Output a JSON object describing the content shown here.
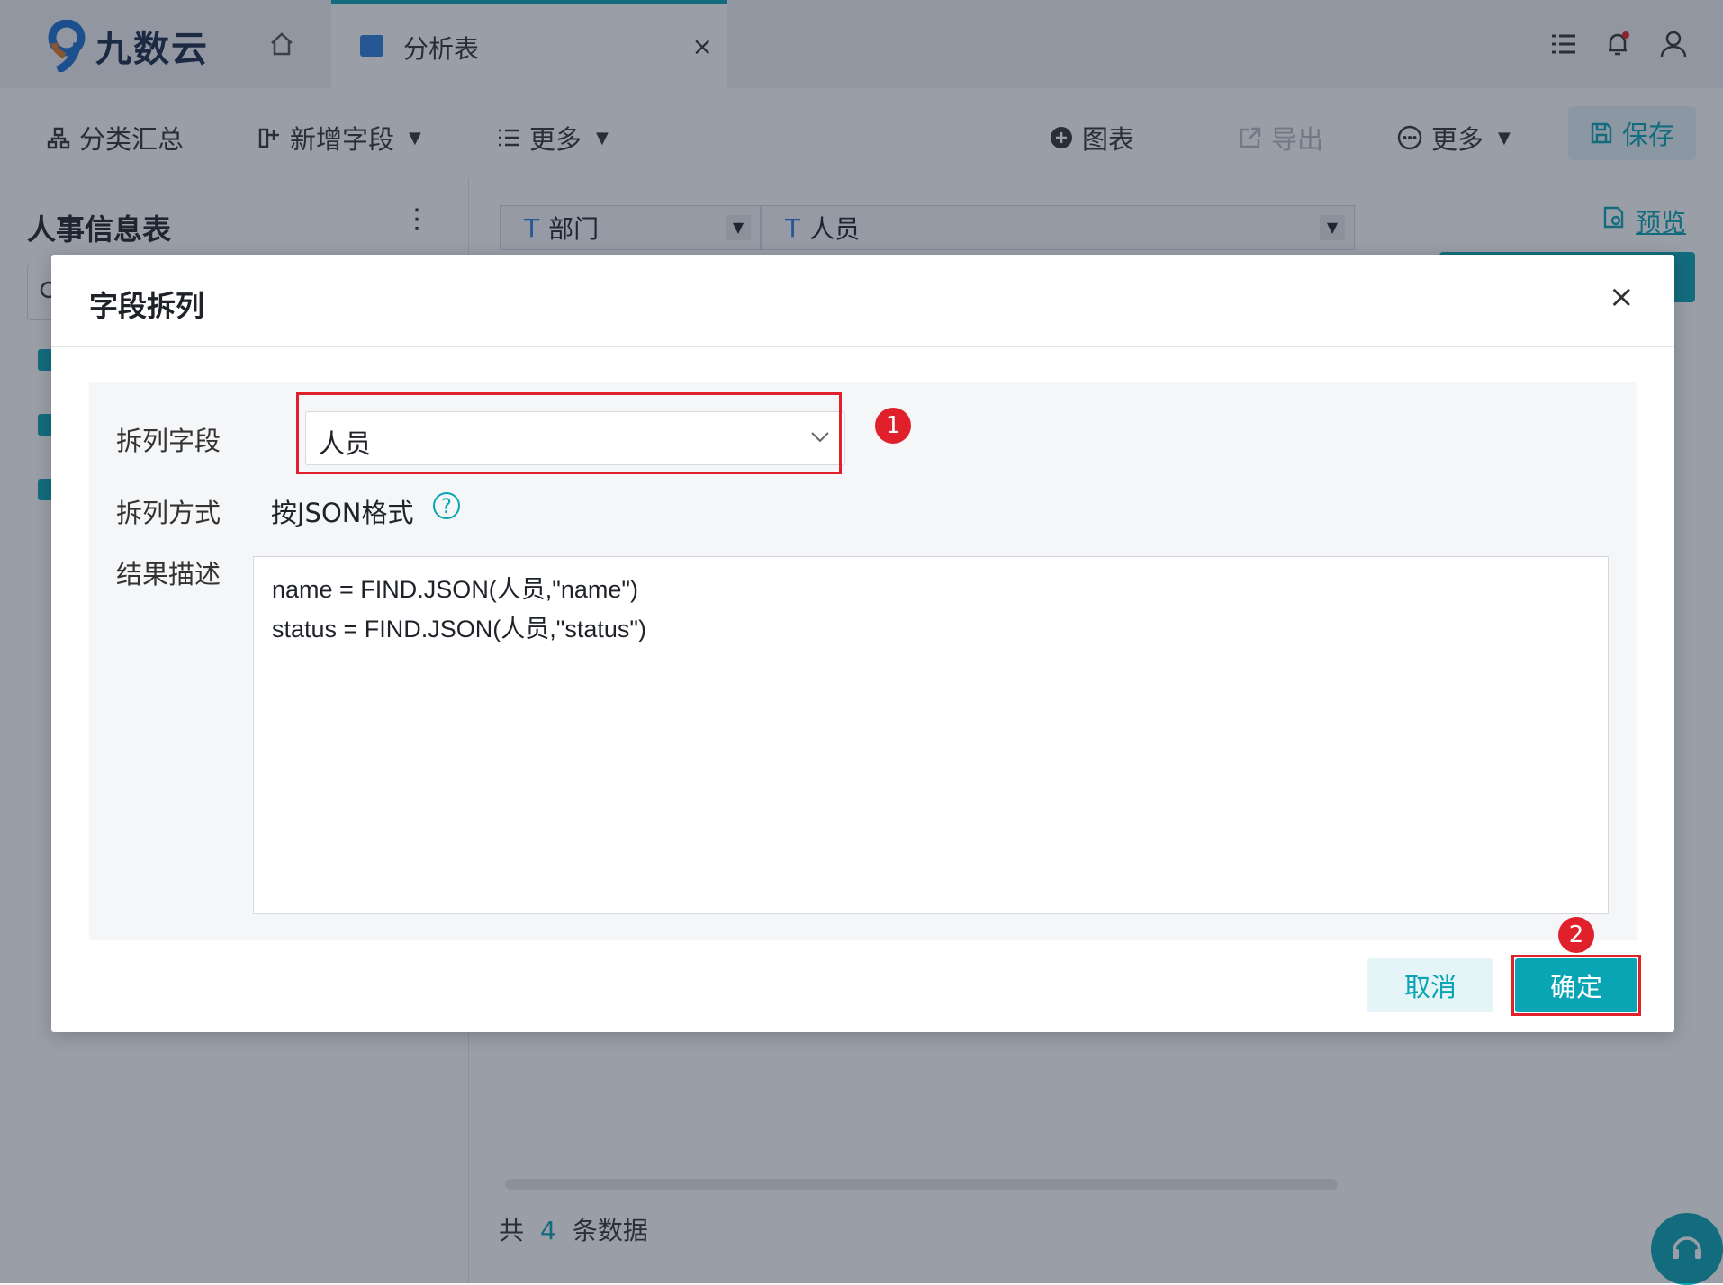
{
  "app": {
    "logo_text": "九数云",
    "brand_color": "#0aa5b4",
    "active_tab_label": "分析表",
    "tab_close": "×"
  },
  "toolbar": {
    "group_summary": "分类汇总",
    "add_field": "新增字段",
    "more_left": "更多",
    "chart": "图表",
    "export": "导出",
    "more_right": "更多",
    "save": "保存"
  },
  "sidebar": {
    "title": "人事信息表",
    "more": "⋮"
  },
  "table": {
    "columns": [
      {
        "type": "T",
        "name": "部门"
      },
      {
        "type": "T",
        "name": "人员"
      }
    ],
    "preview": "预览",
    "footer_prefix": "共",
    "row_count": "4",
    "footer_suffix": "条数据"
  },
  "dialog": {
    "title": "字段拆列",
    "close": "×",
    "split_field_label": "拆列字段",
    "split_field_value": "人员",
    "split_method_label": "拆列方式",
    "split_method_value": "按JSON格式",
    "help": "?",
    "result_label": "结果描述",
    "result_lines": [
      "name = FIND.JSON(人员,\"name\")",
      "status = FIND.JSON(人员,\"status\")"
    ],
    "cancel": "取消",
    "confirm": "确定",
    "annotation_1": "1",
    "annotation_2": "2",
    "highlight_color": "#e0212b"
  }
}
